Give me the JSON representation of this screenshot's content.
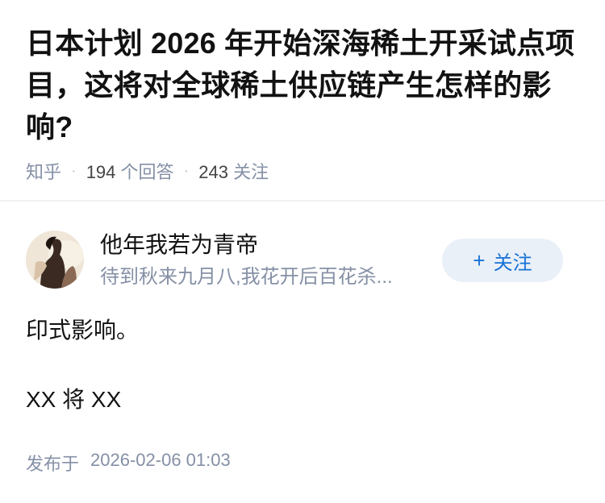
{
  "question": {
    "title": "日本计划 2026 年开始深海稀土开采试点项目，这将对全球稀土供应链产生怎样的影响?",
    "source": "知乎",
    "answers_count": "194",
    "answers_label": "个回答",
    "followers_count": "243",
    "followers_label": "关注"
  },
  "author": {
    "name": "他年我若为青帝",
    "bio": "待到秋来九月八,我花开后百花杀...",
    "avatar_icon": "user-avatar",
    "follow_button": {
      "icon": "plus-icon",
      "plus": "+",
      "label": "关注"
    }
  },
  "answer": {
    "paragraphs": [
      "印式影响。",
      "XX 将 XX"
    ]
  },
  "published": {
    "label": "发布于",
    "datetime": "2026-02-06 01:03"
  },
  "colors": {
    "title": "#121212",
    "meta": "#8590a6",
    "follow_bg": "#eaf0f8",
    "follow_text": "#1772d6",
    "divider": "#f2f2f2"
  }
}
